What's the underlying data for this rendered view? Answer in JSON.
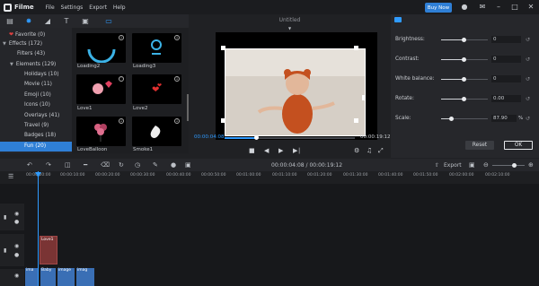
{
  "app": {
    "name": "Filme",
    "menu": [
      "File",
      "Settings",
      "Export",
      "Help"
    ],
    "buy_now": "Buy Now"
  },
  "preview": {
    "title": "Untitled",
    "current_time": "00:00:04:08",
    "total_time": "00:00:19:12"
  },
  "sidebar": {
    "items": [
      {
        "label": "Favorite (0)"
      },
      {
        "label": "Effects (172)"
      },
      {
        "label": "Filters (43)"
      },
      {
        "label": "Elements (129)"
      },
      {
        "label": "Holidays (10)"
      },
      {
        "label": "Movie (11)"
      },
      {
        "label": "Emoji (10)"
      },
      {
        "label": "Icons (10)"
      },
      {
        "label": "Overlays (41)"
      },
      {
        "label": "Travel (9)"
      },
      {
        "label": "Badges (18)"
      },
      {
        "label": "Fun (20)"
      }
    ]
  },
  "effects": [
    {
      "label": "Loading2"
    },
    {
      "label": "Loading3"
    },
    {
      "label": "Love1"
    },
    {
      "label": "Love2"
    },
    {
      "label": "LoveBalloon"
    },
    {
      "label": "Smoke1"
    }
  ],
  "props": {
    "brightness": {
      "label": "Brightness:",
      "value": "0",
      "level": 0.5
    },
    "contrast": {
      "label": "Contrast:",
      "value": "0",
      "level": 0.5
    },
    "white_balance": {
      "label": "White balance:",
      "value": "0",
      "level": 0.5
    },
    "rotate": {
      "label": "Rotate:",
      "value": "0.00",
      "level": 0.5
    },
    "scale": {
      "label": "Scale:",
      "value": "87.90",
      "unit": "%",
      "level": 0.22
    },
    "reset_label": "Reset",
    "ok_label": "OK"
  },
  "timeline": {
    "timecode": "00:00:04:08 / 00:00:19:12",
    "export_label": "Export",
    "ruler": [
      "00:00:00:00",
      "00:00:10:00",
      "00:00:20:00",
      "00:00:30:00",
      "00:00:40:00",
      "00:00:50:00",
      "00:01:00:00",
      "00:01:10:00",
      "00:01:20:00",
      "00:01:30:00",
      "00:01:40:00",
      "00:01:50:00",
      "00:02:00:00",
      "00:02:10:00"
    ],
    "effect_clip": "Love1",
    "media_clips": [
      "ima",
      "Baby",
      "image",
      "imag"
    ]
  },
  "colors": {
    "accent": "#2f7fd6",
    "playhead": "#2f9bff",
    "effect_clip": "#7a3434"
  }
}
